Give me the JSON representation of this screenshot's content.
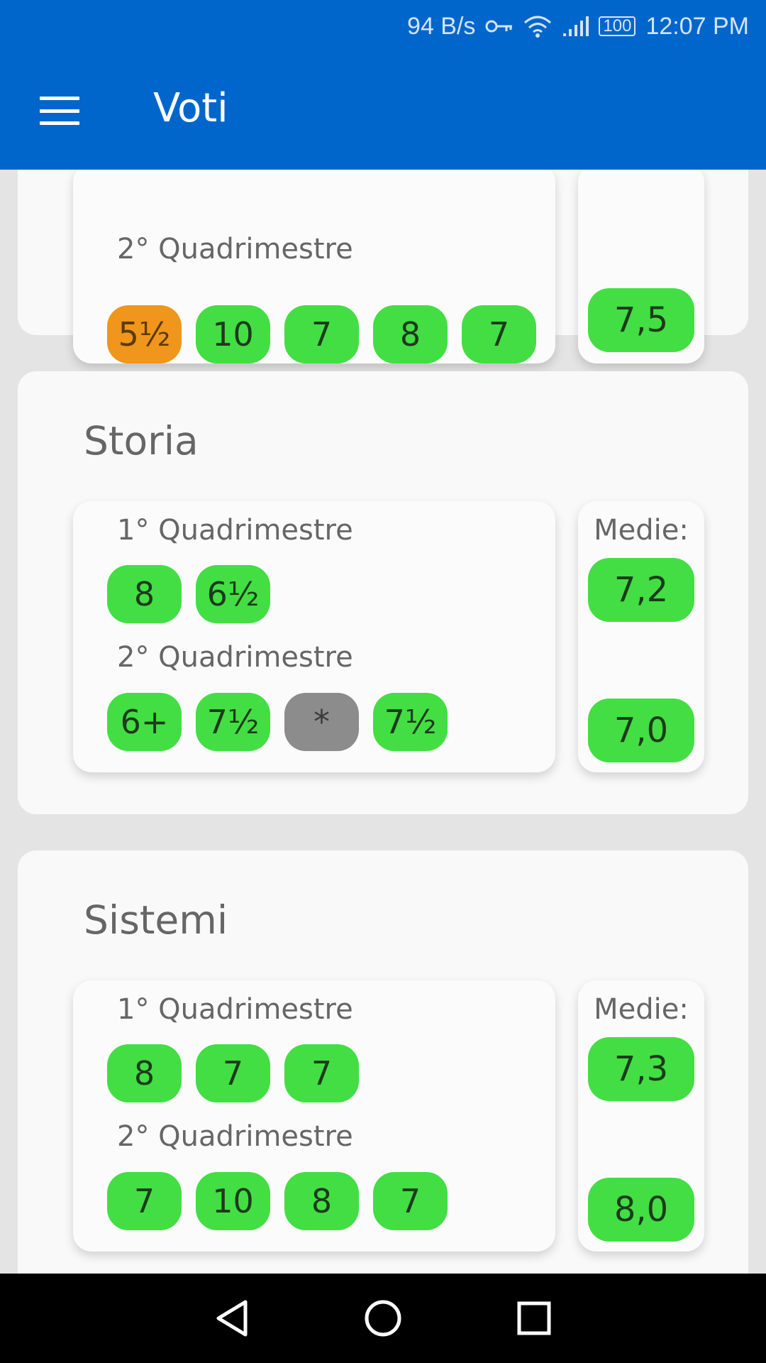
{
  "status_bar": {
    "net_speed": "94 B/s",
    "battery": "100",
    "time": "12:07 PM",
    "icons": [
      "vpn-key-icon",
      "wifi-icon",
      "signal-icon",
      "battery-icon"
    ]
  },
  "app_bar": {
    "title": "Voti",
    "menu_icon": "hamburger-menu-icon"
  },
  "colors": {
    "app_bar": "#0066cc",
    "grade_pass": "#43de43",
    "grade_warn": "#f0961c",
    "grade_unknown": "#8c8c8c"
  },
  "subjects": [
    {
      "q2_label": "2° Quadrimestre",
      "q2_grades": [
        "5½",
        "10",
        "7",
        "8",
        "7"
      ],
      "q2_avg": "7,5"
    },
    {
      "name": "Storia",
      "q1_label": "1° Quadrimestre",
      "q1_grades": [
        "8",
        "6½"
      ],
      "q2_label": "2° Quadrimestre",
      "q2_grades": [
        "6+",
        "7½",
        "*",
        "7½"
      ],
      "medie_label": "Medie:",
      "q1_avg": "7,2",
      "q2_avg": "7,0"
    },
    {
      "name": "Sistemi",
      "q1_label": "1° Quadrimestre",
      "q1_grades": [
        "8",
        "7",
        "7"
      ],
      "q2_label": "2° Quadrimestre",
      "q2_grades": [
        "7",
        "10",
        "8",
        "7"
      ],
      "medie_label": "Medie:",
      "q1_avg": "7,3",
      "q2_avg": "8,0"
    }
  ],
  "nav_bar": {
    "buttons": [
      "back-icon",
      "home-icon",
      "recents-icon"
    ]
  }
}
